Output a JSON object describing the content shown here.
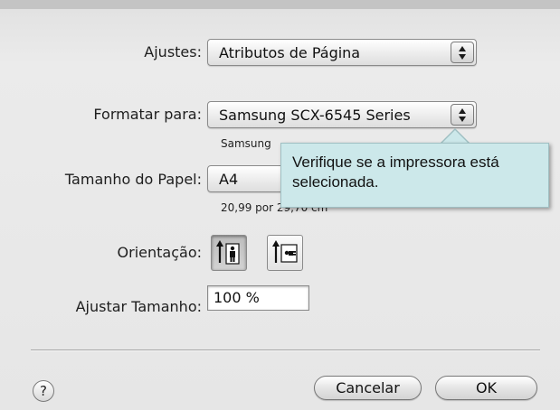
{
  "settings": {
    "label": "Ajustes:",
    "value": "Atributos de Página"
  },
  "format_for": {
    "label": "Formatar para:",
    "value": "Samsung SCX-6545 Series",
    "sublabel": "Samsung"
  },
  "paper_size": {
    "label": "Tamanho do Papel:",
    "value": "A4",
    "dimensions": "20,99 por 29,70 cm"
  },
  "orientation": {
    "label": "Orientação:",
    "options": [
      "portrait",
      "landscape"
    ],
    "selected": "portrait"
  },
  "scale": {
    "label": "Ajustar Tamanho:",
    "value": "100 %"
  },
  "buttons": {
    "help": "?",
    "cancel": "Cancelar",
    "ok": "OK"
  },
  "tooltip": {
    "text": "Verifique se a impressora está selecionada."
  },
  "colors": {
    "tooltip_bg": "#cce8ea",
    "dialog_bg": "#e6e6e6"
  }
}
